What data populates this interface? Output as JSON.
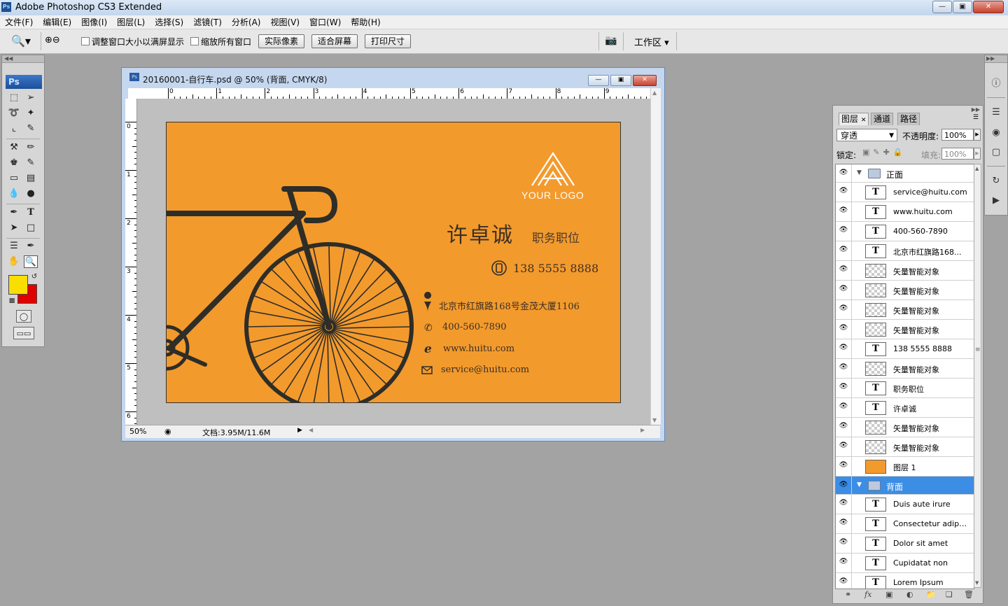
{
  "app": {
    "title": "Adobe Photoshop CS3 Extended",
    "icon_label": "Ps",
    "window_buttons": [
      "minimize-icon",
      "maximize-icon",
      "close-icon"
    ]
  },
  "menubar": {
    "items": [
      "文件(F)",
      "编辑(E)",
      "图像(I)",
      "图层(L)",
      "选择(S)",
      "滤镜(T)",
      "分析(A)",
      "视图(V)",
      "窗口(W)",
      "帮助(H)"
    ]
  },
  "options": {
    "tool_icon": "zoom-tool-icon",
    "resize_windows_label": "调整窗口大小以满屏显示",
    "zoom_all_label": "缩放所有窗口",
    "actual_pixels": "实际像素",
    "fit_screen": "适合屏幕",
    "print_size": "打印尺寸",
    "workspace": "工作区"
  },
  "tools": {
    "logo": "Ps",
    "foreground_color": "#f9de00",
    "background_color": "#e00000"
  },
  "document": {
    "title": "20160001-自行车.psd @ 50% (背面, CMYK/8)",
    "zoom": "50%",
    "doc_info": "文档:3.95M/11.6M",
    "ruler_top": [
      "0",
      "1",
      "2",
      "3",
      "4",
      "5",
      "6",
      "7",
      "8",
      "9"
    ],
    "ruler_left": [
      "0",
      "1",
      "2",
      "3",
      "4",
      "5",
      "6"
    ]
  },
  "card": {
    "background": "#f39a2d",
    "logo_text": "YOUR LOGO",
    "name": "许卓诚",
    "job": "职务职位",
    "mobile": "138 5555 8888",
    "address": "北京市红旗路168号金茂大厦1106",
    "phone": "400-560-7890",
    "website": "www.huitu.com",
    "email": "service@huitu.com"
  },
  "layers": {
    "tabs": [
      "图层",
      "通道",
      "路径"
    ],
    "blend_mode": "穿透",
    "opacity_label": "不透明度:",
    "opacity_value": "100%",
    "lock_label": "锁定:",
    "fill_label": "填充:",
    "fill_value": "100%",
    "items": [
      {
        "name": "正面",
        "kind": "group"
      },
      {
        "name": "service@huitu.com",
        "kind": "text"
      },
      {
        "name": "www.huitu.com",
        "kind": "text"
      },
      {
        "name": "400-560-7890",
        "kind": "text"
      },
      {
        "name": "北京市红旗路168...",
        "kind": "text"
      },
      {
        "name": "矢量智能对象",
        "kind": "smart"
      },
      {
        "name": "矢量智能对象",
        "kind": "smart"
      },
      {
        "name": "矢量智能对象",
        "kind": "smart"
      },
      {
        "name": "矢量智能对象",
        "kind": "smart"
      },
      {
        "name": "138 5555 8888",
        "kind": "text"
      },
      {
        "name": "矢量智能对象",
        "kind": "smart"
      },
      {
        "name": "职务职位",
        "kind": "text"
      },
      {
        "name": "许卓诚",
        "kind": "text"
      },
      {
        "name": "矢量智能对象",
        "kind": "smart"
      },
      {
        "name": "矢量智能对象",
        "kind": "smart"
      },
      {
        "name": "图层 1",
        "kind": "fill"
      },
      {
        "name": "背面",
        "kind": "group",
        "selected": true
      },
      {
        "name": "Duis aute irure",
        "kind": "text"
      },
      {
        "name": "Consectetur adipis...",
        "kind": "text"
      },
      {
        "name": "Dolor sit amet",
        "kind": "text"
      },
      {
        "name": "Cupidatat non",
        "kind": "text"
      },
      {
        "name": "Lorem Ipsum",
        "kind": "text"
      }
    ],
    "bottom_icons": [
      "link-icon",
      "fx-icon",
      "mask-icon",
      "adjustment-icon",
      "new-group-icon",
      "new-layer-icon",
      "trash-icon"
    ]
  }
}
